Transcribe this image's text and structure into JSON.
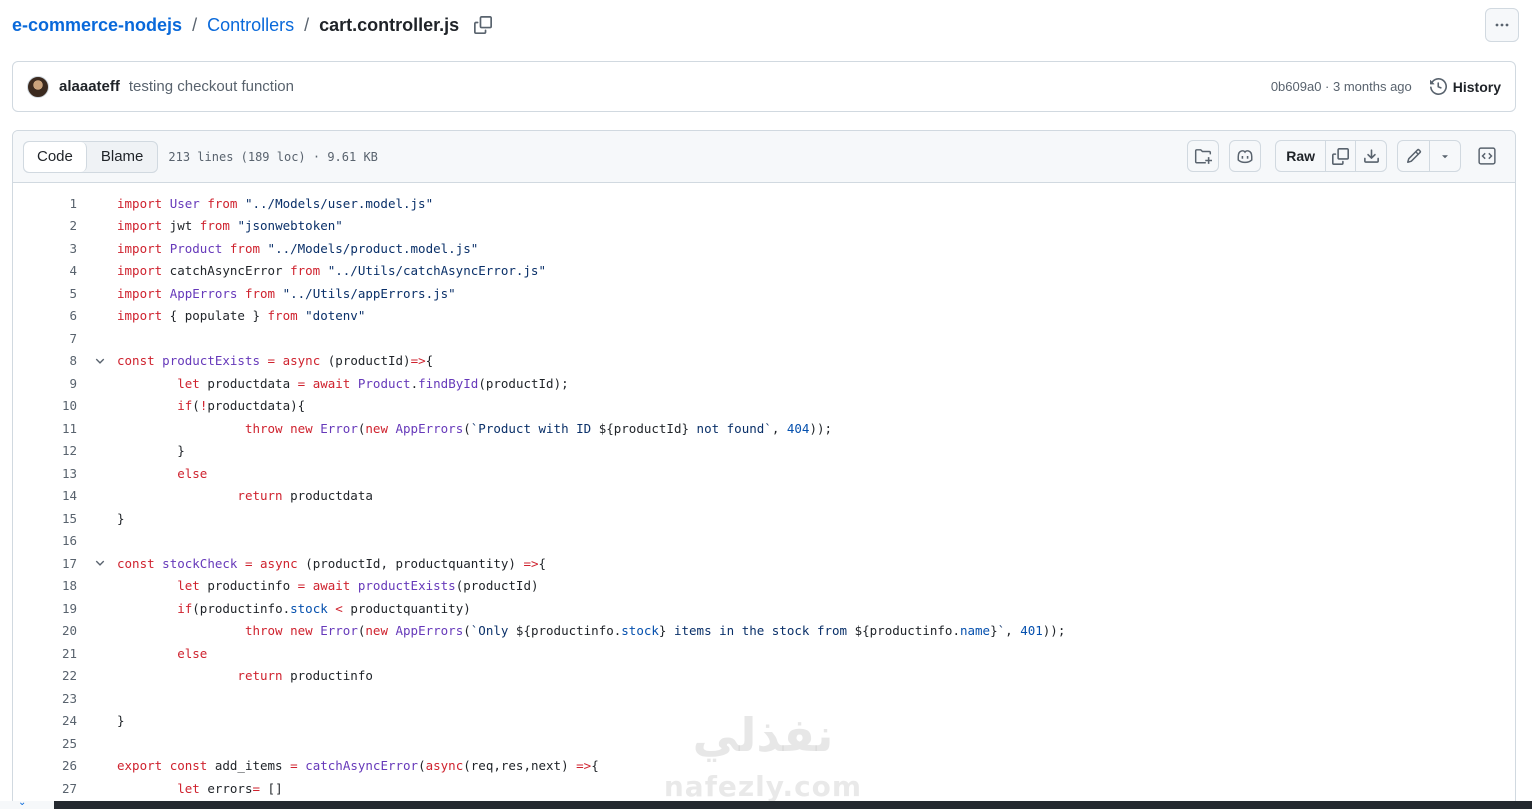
{
  "breadcrumb": {
    "repo": "e-commerce-nodejs",
    "separator": "/",
    "dir": "Controllers",
    "file": "cart.controller.js"
  },
  "commit": {
    "author": "alaaateff",
    "message": "testing checkout function",
    "meta": "0b609a0 · 3 months ago",
    "history_label": "History"
  },
  "file_header": {
    "tab_code": "Code",
    "tab_blame": "Blame",
    "stats": "213 lines (189 loc) · 9.61 KB",
    "raw_label": "Raw"
  },
  "code_lines": [
    {
      "n": "1",
      "fold": false,
      "tokens": [
        [
          "k",
          "import"
        ],
        [
          "t",
          " "
        ],
        [
          "f",
          "User"
        ],
        [
          "t",
          " "
        ],
        [
          "k",
          "from"
        ],
        [
          "t",
          " "
        ],
        [
          "s",
          "\"../Models/user.model.js\""
        ]
      ]
    },
    {
      "n": "2",
      "fold": false,
      "tokens": [
        [
          "k",
          "import"
        ],
        [
          "t",
          " jwt "
        ],
        [
          "k",
          "from"
        ],
        [
          "t",
          " "
        ],
        [
          "s",
          "\"jsonwebtoken\""
        ]
      ]
    },
    {
      "n": "3",
      "fold": false,
      "tokens": [
        [
          "k",
          "import"
        ],
        [
          "t",
          " "
        ],
        [
          "f",
          "Product"
        ],
        [
          "t",
          " "
        ],
        [
          "k",
          "from"
        ],
        [
          "t",
          " "
        ],
        [
          "s",
          "\"../Models/product.model.js\""
        ]
      ]
    },
    {
      "n": "4",
      "fold": false,
      "tokens": [
        [
          "k",
          "import"
        ],
        [
          "t",
          " catchAsyncError "
        ],
        [
          "k",
          "from"
        ],
        [
          "t",
          " "
        ],
        [
          "s",
          "\"../Utils/catchAsyncError.js\""
        ]
      ]
    },
    {
      "n": "5",
      "fold": false,
      "tokens": [
        [
          "k",
          "import"
        ],
        [
          "t",
          " "
        ],
        [
          "f",
          "AppErrors"
        ],
        [
          "t",
          " "
        ],
        [
          "k",
          "from"
        ],
        [
          "t",
          " "
        ],
        [
          "s",
          "\"../Utils/appErrors.js\""
        ]
      ]
    },
    {
      "n": "6",
      "fold": false,
      "tokens": [
        [
          "k",
          "import"
        ],
        [
          "t",
          " { populate } "
        ],
        [
          "k",
          "from"
        ],
        [
          "t",
          " "
        ],
        [
          "s",
          "\"dotenv\""
        ]
      ]
    },
    {
      "n": "7",
      "fold": false,
      "tokens": []
    },
    {
      "n": "8",
      "fold": true,
      "tokens": [
        [
          "k",
          "const"
        ],
        [
          "t",
          " "
        ],
        [
          "f",
          "productExists"
        ],
        [
          "t",
          " "
        ],
        [
          "k",
          "="
        ],
        [
          "t",
          " "
        ],
        [
          "k",
          "async"
        ],
        [
          "t",
          " (productId)"
        ],
        [
          "k",
          "=>"
        ],
        [
          "t",
          "{"
        ]
      ]
    },
    {
      "n": "9",
      "fold": false,
      "tokens": [
        [
          "t",
          "        "
        ],
        [
          "k",
          "let"
        ],
        [
          "t",
          " productdata "
        ],
        [
          "k",
          "="
        ],
        [
          "t",
          " "
        ],
        [
          "k",
          "await"
        ],
        [
          "t",
          " "
        ],
        [
          "f",
          "Product"
        ],
        [
          "t",
          "."
        ],
        [
          "f",
          "findById"
        ],
        [
          "t",
          "(productId);"
        ]
      ]
    },
    {
      "n": "10",
      "fold": false,
      "tokens": [
        [
          "t",
          "        "
        ],
        [
          "k",
          "if"
        ],
        [
          "t",
          "("
        ],
        [
          "k",
          "!"
        ],
        [
          "t",
          "productdata){"
        ]
      ]
    },
    {
      "n": "11",
      "fold": false,
      "tokens": [
        [
          "t",
          "                 "
        ],
        [
          "k",
          "throw"
        ],
        [
          "t",
          " "
        ],
        [
          "k",
          "new"
        ],
        [
          "t",
          " "
        ],
        [
          "f",
          "Error"
        ],
        [
          "t",
          "("
        ],
        [
          "k",
          "new"
        ],
        [
          "t",
          " "
        ],
        [
          "f",
          "AppErrors"
        ],
        [
          "t",
          "("
        ],
        [
          "s",
          "`Product with ID "
        ],
        [
          "t",
          "${productId}"
        ],
        [
          "s",
          " not found`"
        ],
        [
          "t",
          ", "
        ],
        [
          "c",
          "404"
        ],
        [
          "t",
          "));"
        ]
      ]
    },
    {
      "n": "12",
      "fold": false,
      "tokens": [
        [
          "t",
          "        }"
        ]
      ]
    },
    {
      "n": "13",
      "fold": false,
      "tokens": [
        [
          "t",
          "        "
        ],
        [
          "k",
          "else"
        ]
      ]
    },
    {
      "n": "14",
      "fold": false,
      "tokens": [
        [
          "t",
          "                "
        ],
        [
          "k",
          "return"
        ],
        [
          "t",
          " productdata"
        ]
      ]
    },
    {
      "n": "15",
      "fold": false,
      "tokens": [
        [
          "t",
          "}"
        ]
      ]
    },
    {
      "n": "16",
      "fold": false,
      "tokens": []
    },
    {
      "n": "17",
      "fold": true,
      "tokens": [
        [
          "k",
          "const"
        ],
        [
          "t",
          " "
        ],
        [
          "f",
          "stockCheck"
        ],
        [
          "t",
          " "
        ],
        [
          "k",
          "="
        ],
        [
          "t",
          " "
        ],
        [
          "k",
          "async"
        ],
        [
          "t",
          " (productId, productquantity) "
        ],
        [
          "k",
          "=>"
        ],
        [
          "t",
          "{"
        ]
      ]
    },
    {
      "n": "18",
      "fold": false,
      "tokens": [
        [
          "t",
          "        "
        ],
        [
          "k",
          "let"
        ],
        [
          "t",
          " productinfo "
        ],
        [
          "k",
          "="
        ],
        [
          "t",
          " "
        ],
        [
          "k",
          "await"
        ],
        [
          "t",
          " "
        ],
        [
          "f",
          "productExists"
        ],
        [
          "t",
          "(productId)"
        ]
      ]
    },
    {
      "n": "19",
      "fold": false,
      "tokens": [
        [
          "t",
          "        "
        ],
        [
          "k",
          "if"
        ],
        [
          "t",
          "(productinfo."
        ],
        [
          "c",
          "stock"
        ],
        [
          "t",
          " "
        ],
        [
          "k",
          "<"
        ],
        [
          "t",
          " productquantity)"
        ]
      ]
    },
    {
      "n": "20",
      "fold": false,
      "tokens": [
        [
          "t",
          "                 "
        ],
        [
          "k",
          "throw"
        ],
        [
          "t",
          " "
        ],
        [
          "k",
          "new"
        ],
        [
          "t",
          " "
        ],
        [
          "f",
          "Error"
        ],
        [
          "t",
          "("
        ],
        [
          "k",
          "new"
        ],
        [
          "t",
          " "
        ],
        [
          "f",
          "AppErrors"
        ],
        [
          "t",
          "("
        ],
        [
          "s",
          "`Only "
        ],
        [
          "t",
          "${productinfo."
        ],
        [
          "c",
          "stock"
        ],
        [
          "t",
          "}"
        ],
        [
          "s",
          " items in the stock from "
        ],
        [
          "t",
          "${productinfo."
        ],
        [
          "c",
          "name"
        ],
        [
          "t",
          "}"
        ],
        [
          "s",
          "`"
        ],
        [
          "t",
          ", "
        ],
        [
          "c",
          "401"
        ],
        [
          "t",
          "));"
        ]
      ]
    },
    {
      "n": "21",
      "fold": false,
      "tokens": [
        [
          "t",
          "        "
        ],
        [
          "k",
          "else"
        ]
      ]
    },
    {
      "n": "22",
      "fold": false,
      "tokens": [
        [
          "t",
          "                "
        ],
        [
          "k",
          "return"
        ],
        [
          "t",
          " productinfo"
        ]
      ]
    },
    {
      "n": "23",
      "fold": false,
      "tokens": []
    },
    {
      "n": "24",
      "fold": false,
      "tokens": [
        [
          "t",
          "}"
        ]
      ]
    },
    {
      "n": "25",
      "fold": false,
      "tokens": []
    },
    {
      "n": "26",
      "fold": false,
      "tokens": [
        [
          "k",
          "export"
        ],
        [
          "t",
          " "
        ],
        [
          "k",
          "const"
        ],
        [
          "t",
          " add_items "
        ],
        [
          "k",
          "="
        ],
        [
          "t",
          " "
        ],
        [
          "f",
          "catchAsyncError"
        ],
        [
          "t",
          "("
        ],
        [
          "k",
          "async"
        ],
        [
          "t",
          "(req,res,next) "
        ],
        [
          "k",
          "=>"
        ],
        [
          "t",
          "{"
        ]
      ]
    },
    {
      "n": "27",
      "fold": false,
      "tokens": [
        [
          "t",
          "        "
        ],
        [
          "k",
          "let"
        ],
        [
          "t",
          " errors"
        ],
        [
          "k",
          "="
        ],
        [
          "t",
          " []"
        ]
      ]
    }
  ],
  "watermark": {
    "arabic": "نفذلي",
    "latin": "nafezly.com"
  },
  "colors": {
    "link": "#0969da",
    "keyword": "#cf222e",
    "entity": "#6639ba",
    "string": "#0a3069",
    "constant": "#0550ae",
    "border": "#d1d9e0",
    "muted": "#59636e"
  },
  "icons": [
    "copy-icon",
    "kebab-icon",
    "history-icon",
    "add-file-icon",
    "copilot-icon",
    "download-icon",
    "pencil-icon",
    "triangle-down-icon",
    "code-square-icon",
    "chevron-down-icon"
  ]
}
